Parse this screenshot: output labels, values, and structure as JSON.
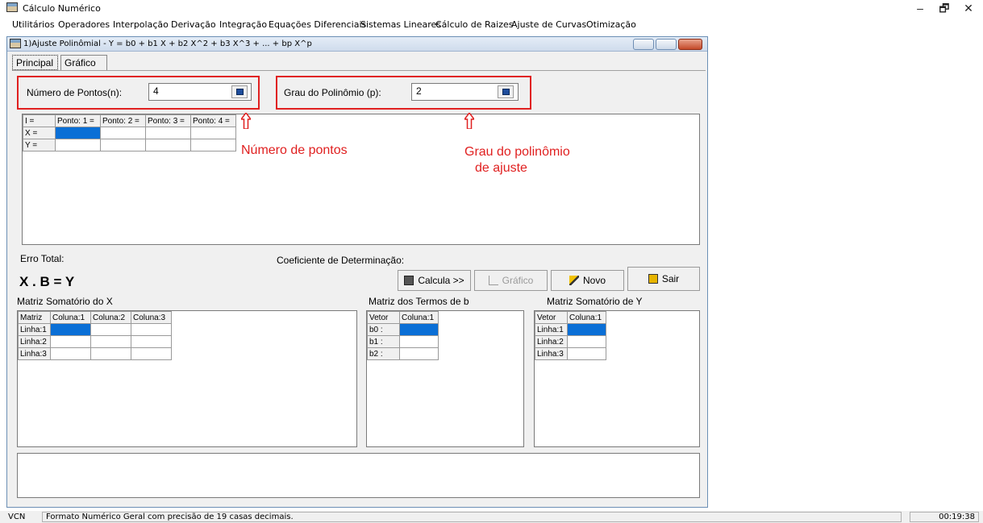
{
  "app": {
    "title": "Cálculo Numérico",
    "window_controls": {
      "minimize": "–",
      "restore": "🗗",
      "close": "✕"
    }
  },
  "menu": [
    "Utilitários",
    "Operadores",
    "Interpolação",
    "Derivação",
    "Integração",
    "Equações Diferenciais",
    "Sistemas Lineares",
    "Cálculo de Raizes",
    "Ajuste de Curvas",
    "Otimização"
  ],
  "child_window": {
    "title": "1)Ajuste Polinômial - Y = b0 + b1 X + b2 X^2 + b3 X^3 + ... + bp X^p"
  },
  "tabs": [
    {
      "label": "Principal",
      "active": true
    },
    {
      "label": "Gráfico",
      "active": false
    }
  ],
  "inputs": {
    "num_points": {
      "label": "Número de Pontos(n):",
      "value": "4"
    },
    "degree": {
      "label": "Grau do Polinômio (p):",
      "value": "2"
    }
  },
  "points_grid": {
    "headers": [
      "I =",
      "Ponto: 1 =",
      "Ponto: 2 =",
      "Ponto: 3 =",
      "Ponto: 4 ="
    ],
    "rows": [
      "X =",
      "Y ="
    ]
  },
  "annotations": {
    "num_points": "Número de pontos",
    "degree_line1": "Grau do polinômio",
    "degree_line2": "de ajuste"
  },
  "results": {
    "erro_total": "Erro Total:",
    "coef_det": "Coeficiente de Determinação:",
    "equation": "X . B = Y"
  },
  "buttons": {
    "calcula": "Calcula >>",
    "grafico": "Gráfico",
    "novo": "Novo",
    "sair": "Sair"
  },
  "matrices": {
    "sum_x": {
      "title": "Matriz Somatório do X",
      "headers": [
        "Matriz",
        "Coluna:1",
        "Coluna:2",
        "Coluna:3"
      ],
      "rows": [
        "Linha:1",
        "Linha:2",
        "Linha:3"
      ]
    },
    "terms_b": {
      "title": "Matriz dos Termos de b",
      "headers": [
        "Vetor",
        "Coluna:1"
      ],
      "rows": [
        "b0 :",
        "b1 :",
        "b2 :"
      ]
    },
    "sum_y": {
      "title": "Matriz Somatório de Y",
      "headers": [
        "Vetor",
        "Coluna:1"
      ],
      "rows": [
        "Linha:1",
        "Linha:2",
        "Linha:3"
      ]
    }
  },
  "status": {
    "mode": "VCN",
    "message": "Formato Numérico Geral com precisão de 19 casas decimais.",
    "time": "00:19:38"
  },
  "colors": {
    "annotation": "#e02020",
    "selection": "#0a6fd6"
  }
}
